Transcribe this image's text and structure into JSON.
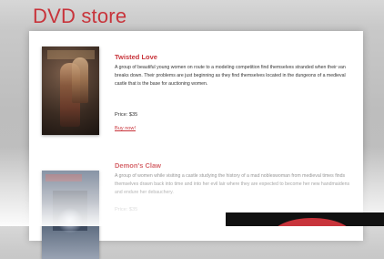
{
  "site": {
    "title": "DVD store"
  },
  "products": [
    {
      "title": "Twisted Love",
      "description": "A group of beautiful young women on route to a modeling competition find themselves stranded when their van breaks down. Their problems are just beginning as they find themselves located in the dungeons of a medieval castle that is the base for auctioning women.",
      "price": "Price: $35",
      "buy_label": "Buy now!"
    },
    {
      "title": "Demon's Claw",
      "description": "A group of women while visiting a castle studying the history of a mad nobleswoman from medieval times finds themselves drawn back into time and into her evil lair where they are expected to become her new handmaidens and endure her debauchery.",
      "price": "Price: $35"
    }
  ],
  "colors": {
    "brand_red": "#c8343b",
    "panel_bg": "#ffffff",
    "page_bg": "#c4c4c4"
  }
}
